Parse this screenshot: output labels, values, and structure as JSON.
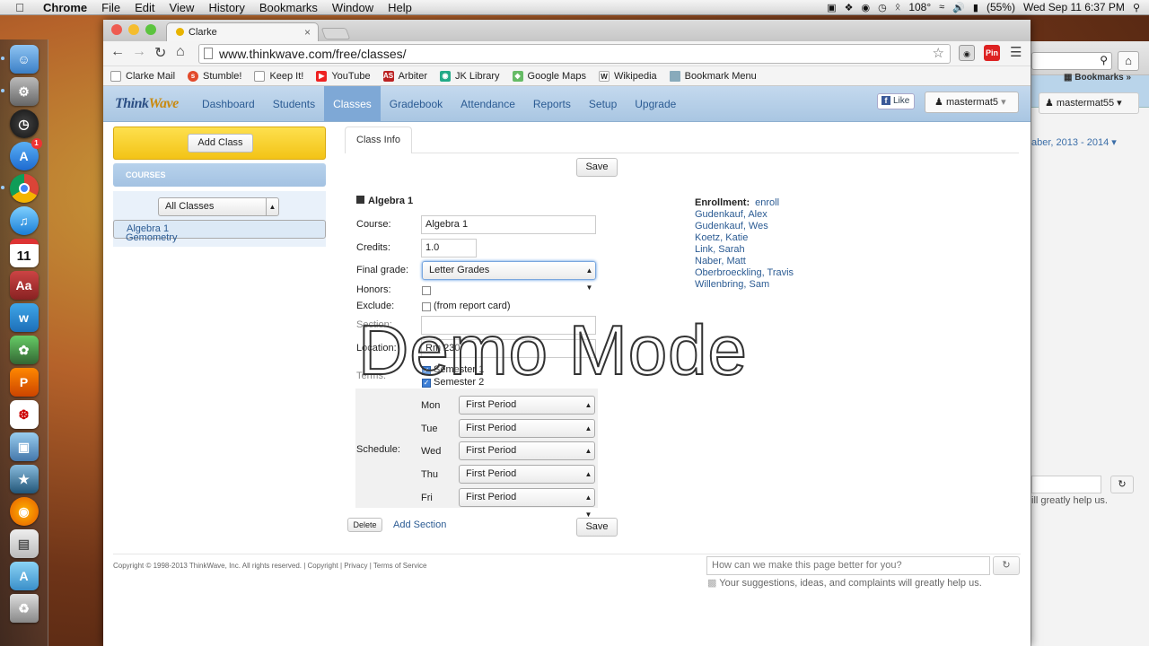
{
  "menubar": {
    "app": "Chrome",
    "items": [
      "File",
      "Edit",
      "View",
      "History",
      "Bookmarks",
      "Window",
      "Help"
    ],
    "temp": "108°",
    "battery": "(55%)",
    "datetime": "Wed Sep 11  6:37 PM"
  },
  "dock": {
    "icons": [
      "finder-icon",
      "system-preferences-icon",
      "dashboard-icon",
      "app-store-icon",
      "chrome-icon",
      "itunes-icon",
      "calendar-icon",
      "dictionary-icon",
      "weebly-icon",
      "evernote-icon",
      "powerpoint-icon",
      "acrobat-icon",
      "preview-icon",
      "imovie-icon",
      "firefox-icon",
      "documents-icon",
      "applications-folder-icon",
      "trash-icon"
    ],
    "calendar_day": "11",
    "badge": "1"
  },
  "browser": {
    "tab_title": "Clarke",
    "url": "www.thinkwave.com/free/classes/",
    "pin_label": "Pin",
    "bookmarks": [
      "Clarke Mail",
      "Stumble!",
      "Keep It!",
      "YouTube",
      "Arbiter",
      "JK Library",
      "Google Maps",
      "Wikipedia",
      "Bookmark Menu"
    ]
  },
  "bg_window": {
    "bookmarks_label": "Bookmarks",
    "user": "mastermat55",
    "term": "aber, 2013 - 2014",
    "note": "ill greatly help us."
  },
  "nav": {
    "logo_a": "Think",
    "logo_b": "Wave",
    "links": [
      "Dashboard",
      "Students",
      "Classes",
      "Gradebook",
      "Attendance",
      "Reports",
      "Setup",
      "Upgrade"
    ],
    "active": "Classes",
    "like": "Like",
    "user": "mastermat5"
  },
  "sidebar": {
    "add_class": "Add Class",
    "courses_header": "COURSES",
    "filter": "All Classes",
    "courses": [
      "Algebra 1",
      "Gemometry"
    ]
  },
  "classinfo": {
    "tab": "Class Info",
    "save": "Save",
    "title": "Algebra 1",
    "course_label": "Course:",
    "course_value": "Algebra 1",
    "credits_label": "Credits:",
    "credits_value": "1.0",
    "final_grade_label": "Final grade:",
    "final_grade_value": "Letter Grades",
    "honors_label": "Honors:",
    "exclude_label": "Exclude:",
    "exclude_note": "(from report card)",
    "section_label": "Section:",
    "location_label": "Location:",
    "location_value": "Rm 230",
    "terms_label": "Terms:",
    "terms": [
      "Semester 1",
      "Semester 2"
    ],
    "schedule_label": "Schedule:",
    "schedule": [
      {
        "day": "Mon",
        "period": "First Period"
      },
      {
        "day": "Tue",
        "period": "First Period"
      },
      {
        "day": "Wed",
        "period": "First Period"
      },
      {
        "day": "Thu",
        "period": "First Period"
      },
      {
        "day": "Fri",
        "period": "First Period"
      }
    ],
    "delete": "Delete",
    "add_section": "Add Section"
  },
  "enrollment": {
    "label": "Enrollment:",
    "link": "enroll",
    "students": [
      "Gudenkauf, Alex",
      "Gudenkauf, Wes",
      "Koetz, Katie",
      "Link, Sarah",
      "Naber, Matt",
      "Oberbroeckling, Travis",
      "Willenbring, Sam"
    ]
  },
  "demo_watermark": "Demo Mode",
  "footer": {
    "copyright": "Copyright © 1998-2013 ThinkWave, Inc. All rights reserved. | Copyright | Privacy | Terms of Service",
    "feedback_placeholder": "How can we make this page better for you?",
    "feedback_note": "Your suggestions, ideas, and complaints will greatly help us."
  }
}
